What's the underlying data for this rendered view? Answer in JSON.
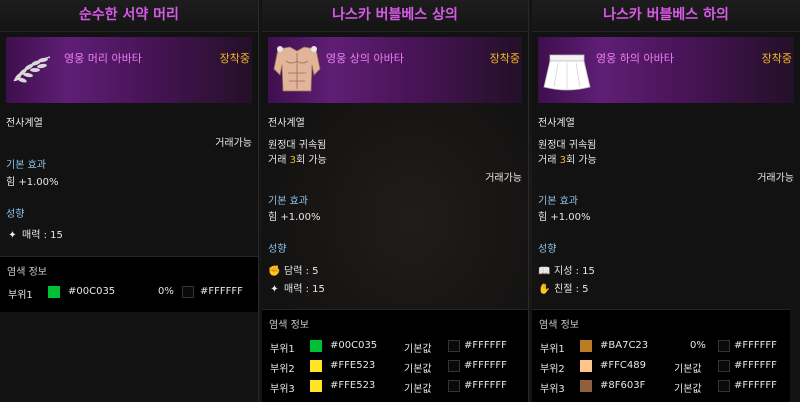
{
  "panels": [
    {
      "title": "순수한 서약 머리",
      "item_type": "영웅 머리 아바타",
      "equipped": "장착중",
      "class_req": "전사계열",
      "trade": "거래가능",
      "basic_effect_label": "기본 효과",
      "basic_effect": "힘 +1.00%",
      "tendency_label": "성향",
      "tendencies": [
        {
          "icon": "sparkle-icon",
          "text": "매력 : 15"
        }
      ],
      "dye_label": "염색 정보",
      "dyes": [
        {
          "part": "부위1",
          "color": "#00C035",
          "hex": "#00C035",
          "mid": "0%",
          "base_hex": "#FFFFFF"
        }
      ]
    },
    {
      "title": "나스카 버블베스 상의",
      "item_type": "영웅 상의 아바타",
      "equipped": "장착중",
      "class_req": "전사계열",
      "bound": "원정대 귀속됨",
      "trade_count_prefix": "거래 ",
      "trade_count": "3",
      "trade_count_suffix": "회 가능",
      "trade": "거래가능",
      "basic_effect_label": "기본 효과",
      "basic_effect": "힘 +1.00%",
      "tendency_label": "성향",
      "tendencies": [
        {
          "icon": "fist-icon",
          "text": "담력 : 5"
        },
        {
          "icon": "sparkle-icon",
          "text": "매력 : 15"
        }
      ],
      "dye_label": "염색 정보",
      "dyes": [
        {
          "part": "부위1",
          "color": "#00C035",
          "hex": "#00C035",
          "mid": "기본값",
          "base_hex": "#FFFFFF"
        },
        {
          "part": "부위2",
          "color": "#FFE523",
          "hex": "#FFE523",
          "mid": "기본값",
          "base_hex": "#FFFFFF"
        },
        {
          "part": "부위3",
          "color": "#FFE523",
          "hex": "#FFE523",
          "mid": "기본값",
          "base_hex": "#FFFFFF"
        }
      ]
    },
    {
      "title": "나스카 버블베스 하의",
      "item_type": "영웅 하의 아바타",
      "equipped": "장착중",
      "class_req": "전사계열",
      "bound": "원정대 귀속됨",
      "trade_count_prefix": "거래 ",
      "trade_count": "3",
      "trade_count_suffix": "회 가능",
      "trade": "거래가능",
      "basic_effect_label": "기본 효과",
      "basic_effect": "힘 +1.00%",
      "tendency_label": "성향",
      "tendencies": [
        {
          "icon": "book-icon",
          "text": "지성 : 15"
        },
        {
          "icon": "hand-icon",
          "text": "친절 : 5"
        }
      ],
      "dye_label": "염색 정보",
      "dyes": [
        {
          "part": "부위1",
          "color": "#BA7C23",
          "hex": "#BA7C23",
          "mid": "0%",
          "base_hex": "#FFFFFF"
        },
        {
          "part": "부위2",
          "color": "#FFC489",
          "hex": "#FFC489",
          "mid": "기본값",
          "base_hex": "#FFFFFF"
        },
        {
          "part": "부위3",
          "color": "#8F603F",
          "hex": "#8F603F",
          "mid": "기본값",
          "base_hex": "#FFFFFF"
        }
      ]
    }
  ],
  "colors": {
    "title": "#D95AE8",
    "item_type": "#E880F2",
    "equipped": "#F2B925",
    "section": "#8EC2EB",
    "trade_count": "#F2B925"
  }
}
